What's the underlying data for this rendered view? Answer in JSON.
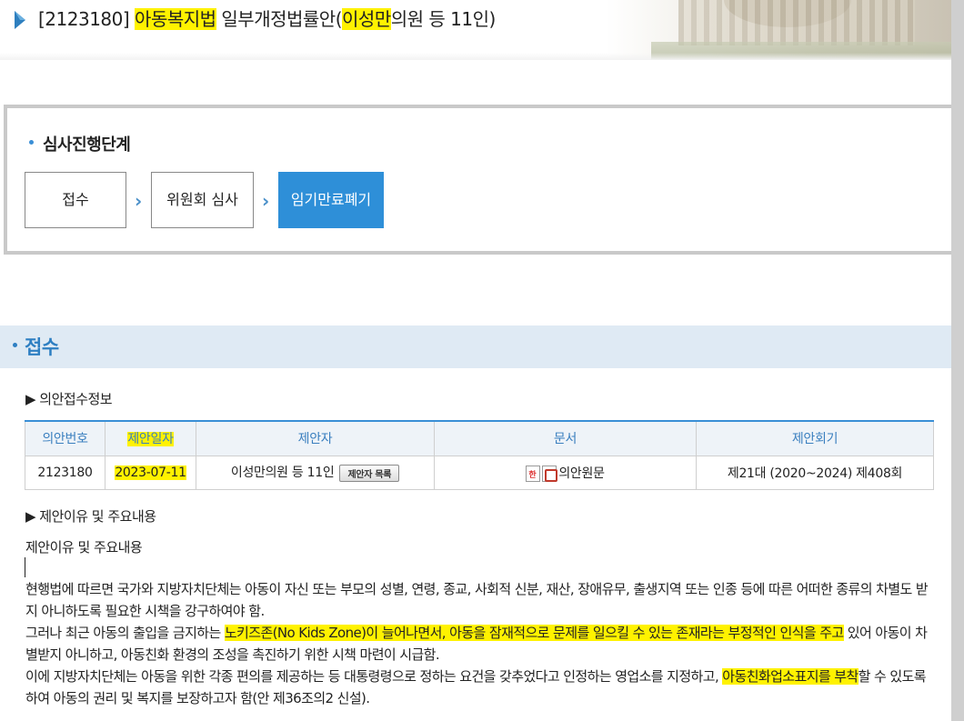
{
  "header": {
    "title_bill_no": "[2123180]",
    "title_law": "아동복지법",
    "title_mid": " 일부개정법률안(",
    "title_proposer": "이성만",
    "title_end": "의원 등 11인)"
  },
  "stage": {
    "title": "심사진행단계",
    "steps": [
      {
        "label": "접수",
        "active": false
      },
      {
        "label": "위원회 심사",
        "active": false
      },
      {
        "label": "임기만료폐기",
        "active": true
      }
    ],
    "arrow": "›"
  },
  "receipt": {
    "section_title": "접수",
    "info_heading": "▶ 의안접수정보",
    "columns": [
      "의안번호",
      "제안일자",
      "제안자",
      "문서",
      "제안회기"
    ],
    "row": {
      "bill_no": "2123180",
      "date": "2023-07-11",
      "proposer": "이성만의원 등 11인",
      "proposer_button": "제안자 목록",
      "document": "의안원문",
      "session": "제21대 (2020~2024) 제408회"
    },
    "reason_heading": "▶ 제안이유 및 주요내용",
    "reason_label": "제안이유 및 주요내용",
    "para1": "현행법에 따르면 국가와 지방자치단체는 아동이 자신 또는 부모의 성별, 연령, 종교, 사회적 신분, 재산, 장애유무, 출생지역 또는 인종 등에 따른 어떠한 종류의 차별도 받지 아니하도록 필요한 시책을 강구하여야 함.",
    "para2_a": "그러나 최근 아동의 출입을 금지하는 ",
    "para2_hl": "노키즈존(No Kids Zone)이 늘어나면서, 아동을 잠재적으로 문제를 일으킬 수 있는 존재라는 부정적인 인식을 주고",
    "para2_b": " 있어 아동이 차별받지 아니하고, 아동친화 환경의 조성을 촉진하기 위한 시책 마련이 시급함.",
    "para3_a": "이에 지방자치단체는 아동을 위한 각종 편의를 제공하는 등 대통령령으로 정하는 요건을 갖추었다고 인정하는 영업소를 지정하고, ",
    "para3_hl": "아동친화업소표지를 부착",
    "para3_b": "할 수 있도록 하여 아동의 권리 및 복지를 보장하고자 함(안 제36조의2 신설)."
  },
  "colors": {
    "accent": "#2e8fd8",
    "highlight": "#fff200",
    "section_bg": "#dfeaf4"
  }
}
